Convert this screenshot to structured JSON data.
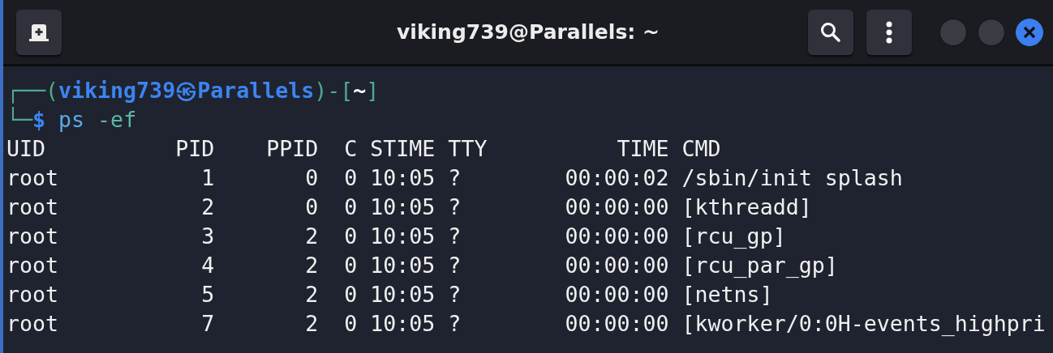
{
  "window": {
    "title": "viking739@Parallels: ~"
  },
  "prompt": [
    [
      {
        "text": "┌──(",
        "kind": "frame"
      },
      {
        "text": "viking739㉿Parallels",
        "kind": "user"
      },
      {
        "text": ")-[",
        "kind": "frame"
      },
      {
        "text": "~",
        "kind": "dir"
      },
      {
        "text": "]",
        "kind": "frame"
      }
    ],
    [
      {
        "text": "└─",
        "kind": "frame"
      },
      {
        "text": "$",
        "kind": "user"
      },
      {
        "text": " ps",
        "kind": "cmd"
      },
      {
        "text": " -ef",
        "kind": "arg"
      }
    ]
  ],
  "output_lines": [
    "UID          PID    PPID  C STIME TTY          TIME CMD",
    "root           1       0  0 10:05 ?        00:00:02 /sbin/init splash",
    "root           2       0  0 10:05 ?        00:00:00 [kthreadd]",
    "root           3       2  0 10:05 ?        00:00:00 [rcu_gp]",
    "root           4       2  0 10:05 ?        00:00:00 [rcu_par_gp]",
    "root           5       2  0 10:05 ?        00:00:00 [netns]",
    "root           7       2  0 10:05 ?        00:00:00 [kworker/0:0H-events_highpri"
  ]
}
